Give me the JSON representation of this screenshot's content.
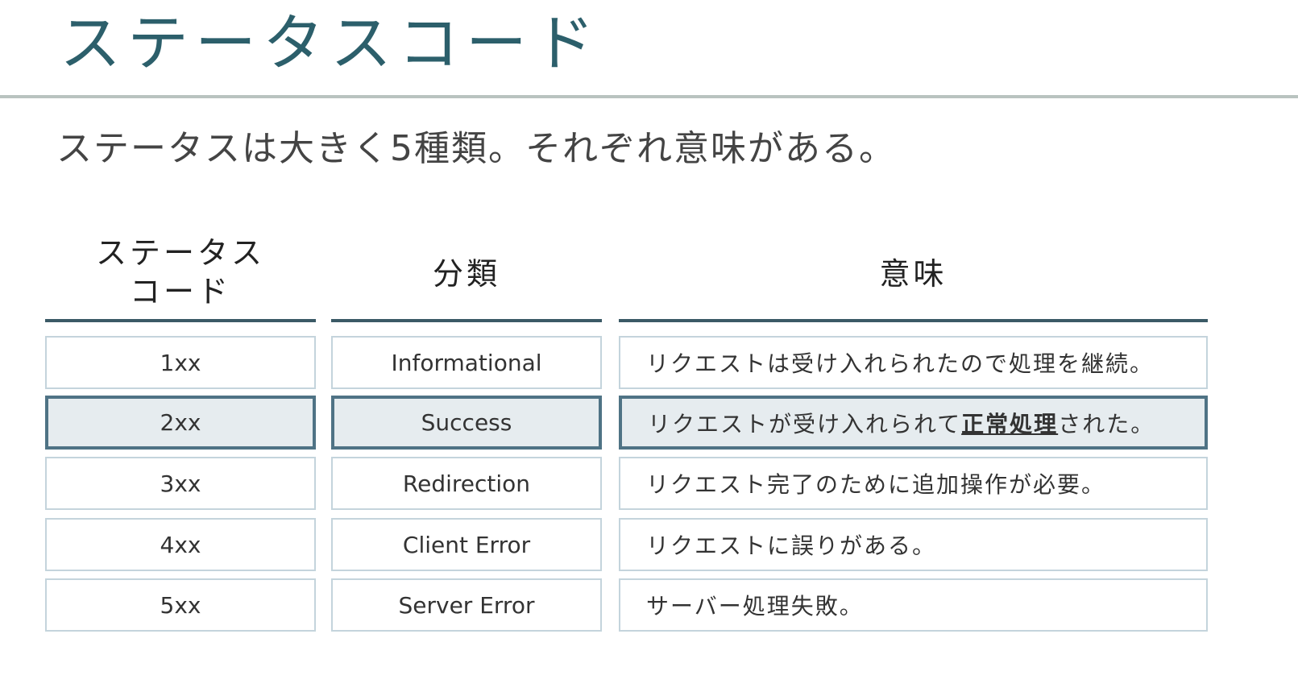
{
  "title": "ステータスコード",
  "subtitle": "ステータスは大きく5種類。それぞれ意味がある。",
  "colors": {
    "title": "#2c5f6b",
    "rule": "#3b5a66",
    "cell_border": "#c4d4dc",
    "highlight_border": "#4f7385",
    "highlight_fill": "#e6ecef"
  },
  "table": {
    "headers": {
      "status_line1": "ステータス",
      "status_line2": "コード",
      "category": "分類",
      "meaning": "意味"
    },
    "rows": [
      {
        "code": "1xx",
        "category": "Informational",
        "meaning_pre": "リクエストは受け入れられたので処理を継続。",
        "meaning_em": "",
        "meaning_post": "",
        "highlight": false
      },
      {
        "code": "2xx",
        "category": "Success",
        "meaning_pre": "リクエストが受け入れられて",
        "meaning_em": "正常処理",
        "meaning_post": "された。",
        "highlight": true
      },
      {
        "code": "3xx",
        "category": "Redirection",
        "meaning_pre": "リクエスト完了のために追加操作が必要。",
        "meaning_em": "",
        "meaning_post": "",
        "highlight": false
      },
      {
        "code": "4xx",
        "category": "Client Error",
        "meaning_pre": "リクエストに誤りがある。",
        "meaning_em": "",
        "meaning_post": "",
        "highlight": false
      },
      {
        "code": "5xx",
        "category": "Server Error",
        "meaning_pre": "サーバー処理失敗。",
        "meaning_em": "",
        "meaning_post": "",
        "highlight": false
      }
    ]
  }
}
